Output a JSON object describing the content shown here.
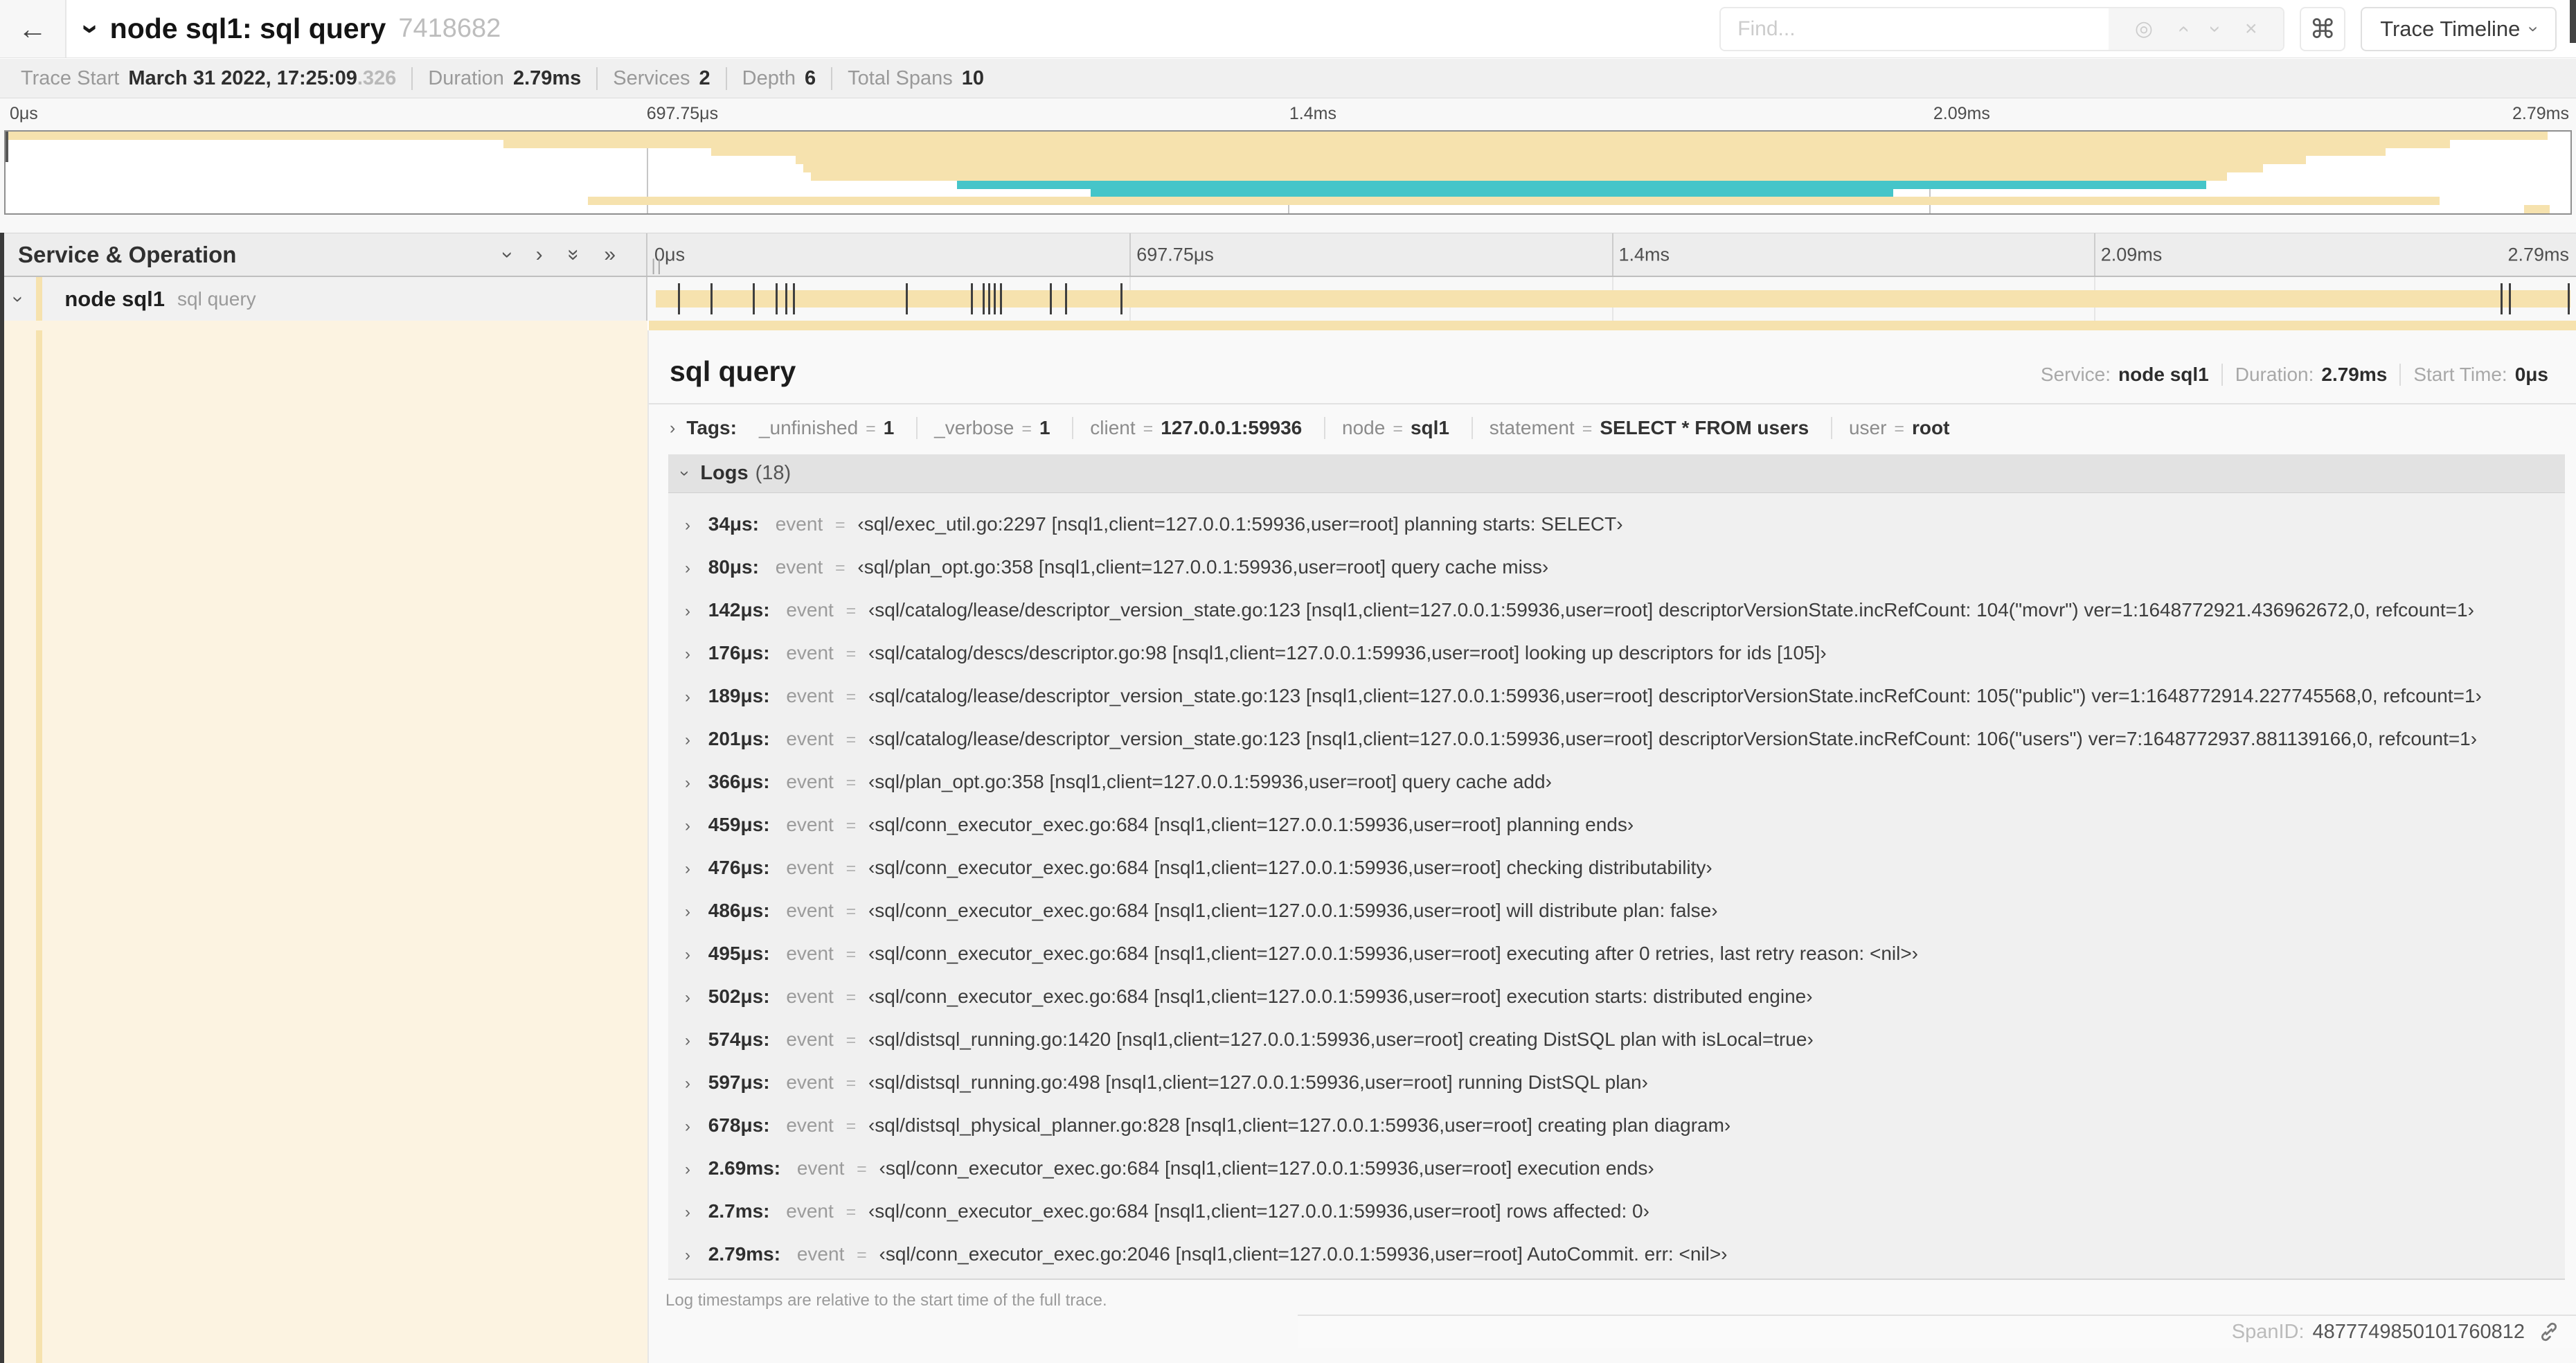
{
  "colors": {
    "tan": "#F6E2AE",
    "teal": "#45C5C9",
    "cream": "#FCF3E1"
  },
  "icons": {
    "back": "←",
    "chevron": "›",
    "double_chevron": "»",
    "bullseye": "◎",
    "close": "×",
    "command": "⌘",
    "resizer": "||"
  },
  "topbar": {
    "title": "node sql1: sql query",
    "trace_id": "7418682",
    "find_placeholder": "Find...",
    "view_button": "Trace Timeline"
  },
  "meta": {
    "items": [
      {
        "label": "Trace Start",
        "value": "March 31 2022, 17:25:09",
        "suffix": ".326"
      },
      {
        "label": "Duration",
        "value": "2.79ms",
        "suffix": ""
      },
      {
        "label": "Services",
        "value": "2",
        "suffix": ""
      },
      {
        "label": "Depth",
        "value": "6",
        "suffix": ""
      },
      {
        "label": "Total Spans",
        "value": "10",
        "suffix": ""
      }
    ]
  },
  "timeline": {
    "ticks": [
      "0μs",
      "697.75μs",
      "1.4ms",
      "2.09ms",
      "2.79ms"
    ]
  },
  "minimap": {
    "rows": [
      {
        "start": 0.0,
        "end": 0.991,
        "color": "tan"
      },
      {
        "start": 0.194,
        "end": 0.953,
        "color": "tan"
      },
      {
        "start": 0.275,
        "end": 0.928,
        "color": "tan"
      },
      {
        "start": 0.308,
        "end": 0.897,
        "color": "tan"
      },
      {
        "start": 0.311,
        "end": 0.88,
        "color": "tan"
      },
      {
        "start": 0.314,
        "end": 0.866,
        "color": "tan"
      },
      {
        "start": 0.371,
        "end": 0.858,
        "color": "teal"
      },
      {
        "start": 0.423,
        "end": 0.736,
        "color": "teal"
      },
      {
        "start": 0.227,
        "end": 0.949,
        "color": "tan"
      },
      {
        "start": 0.982,
        "end": 0.992,
        "color": "tan"
      }
    ]
  },
  "left_head": {
    "title": "Service & Operation"
  },
  "span_row": {
    "service": "node sql1",
    "operation": "sql query",
    "marker_fractions": [
      0.012,
      0.029,
      0.051,
      0.063,
      0.068,
      0.072,
      0.131,
      0.165,
      0.171,
      0.174,
      0.177,
      0.18,
      0.206,
      0.214,
      0.243,
      0.964,
      0.968,
      0.999
    ]
  },
  "detail": {
    "title": "sql query",
    "meta": [
      {
        "label": "Service:",
        "value": "node sql1"
      },
      {
        "label": "Duration:",
        "value": "2.79ms"
      },
      {
        "label": "Start Time:",
        "value": "0μs"
      }
    ]
  },
  "tags": {
    "label": "Tags:",
    "separator": "=",
    "items": [
      {
        "key": "_unfinished",
        "value": "1"
      },
      {
        "key": "_verbose",
        "value": "1"
      },
      {
        "key": "client",
        "value": "127.0.0.1:59936"
      },
      {
        "key": "node",
        "value": "sql1"
      },
      {
        "key": "statement",
        "value": "SELECT * FROM users"
      },
      {
        "key": "user",
        "value": "root"
      }
    ]
  },
  "logs": {
    "label": "Logs",
    "count": "(18)",
    "key": "event",
    "separator": "=",
    "rows": [
      {
        "time": "34μs:",
        "value": "‹sql/exec_util.go:2297 [nsql1,client=127.0.0.1:59936,user=root] planning starts: SELECT›"
      },
      {
        "time": "80μs:",
        "value": "‹sql/plan_opt.go:358 [nsql1,client=127.0.0.1:59936,user=root] query cache miss›"
      },
      {
        "time": "142μs:",
        "value": "‹sql/catalog/lease/descriptor_version_state.go:123 [nsql1,client=127.0.0.1:59936,user=root] descriptorVersionState.incRefCount: 104(\"movr\") ver=1:1648772921.436962672,0, refcount=1›"
      },
      {
        "time": "176μs:",
        "value": "‹sql/catalog/descs/descriptor.go:98 [nsql1,client=127.0.0.1:59936,user=root] looking up descriptors for ids [105]›"
      },
      {
        "time": "189μs:",
        "value": "‹sql/catalog/lease/descriptor_version_state.go:123 [nsql1,client=127.0.0.1:59936,user=root] descriptorVersionState.incRefCount: 105(\"public\") ver=1:1648772914.227745568,0, refcount=1›"
      },
      {
        "time": "201μs:",
        "value": "‹sql/catalog/lease/descriptor_version_state.go:123 [nsql1,client=127.0.0.1:59936,user=root] descriptorVersionState.incRefCount: 106(\"users\") ver=7:1648772937.881139166,0, refcount=1›"
      },
      {
        "time": "366μs:",
        "value": "‹sql/plan_opt.go:358 [nsql1,client=127.0.0.1:59936,user=root] query cache add›"
      },
      {
        "time": "459μs:",
        "value": "‹sql/conn_executor_exec.go:684 [nsql1,client=127.0.0.1:59936,user=root] planning ends›"
      },
      {
        "time": "476μs:",
        "value": "‹sql/conn_executor_exec.go:684 [nsql1,client=127.0.0.1:59936,user=root] checking distributability›"
      },
      {
        "time": "486μs:",
        "value": "‹sql/conn_executor_exec.go:684 [nsql1,client=127.0.0.1:59936,user=root] will distribute plan: false›"
      },
      {
        "time": "495μs:",
        "value": "‹sql/conn_executor_exec.go:684 [nsql1,client=127.0.0.1:59936,user=root] executing after 0 retries, last retry reason: <nil>›"
      },
      {
        "time": "502μs:",
        "value": "‹sql/conn_executor_exec.go:684 [nsql1,client=127.0.0.1:59936,user=root] execution starts: distributed engine›"
      },
      {
        "time": "574μs:",
        "value": "‹sql/distsql_running.go:1420 [nsql1,client=127.0.0.1:59936,user=root] creating DistSQL plan with isLocal=true›"
      },
      {
        "time": "597μs:",
        "value": "‹sql/distsql_running.go:498 [nsql1,client=127.0.0.1:59936,user=root] running DistSQL plan›"
      },
      {
        "time": "678μs:",
        "value": "‹sql/distsql_physical_planner.go:828 [nsql1,client=127.0.0.1:59936,user=root] creating plan diagram›"
      },
      {
        "time": "2.69ms:",
        "value": "‹sql/conn_executor_exec.go:684 [nsql1,client=127.0.0.1:59936,user=root] execution ends›"
      },
      {
        "time": "2.7ms:",
        "value": "‹sql/conn_executor_exec.go:684 [nsql1,client=127.0.0.1:59936,user=root] rows affected: 0›"
      },
      {
        "time": "2.79ms:",
        "value": "‹sql/conn_executor_exec.go:2046 [nsql1,client=127.0.0.1:59936,user=root] AutoCommit. err: <nil>›"
      }
    ],
    "footer": "Log timestamps are relative to the start time of the full trace."
  },
  "footer": {
    "spanid_label": "SpanID:",
    "spanid": "4877749850101760812"
  }
}
